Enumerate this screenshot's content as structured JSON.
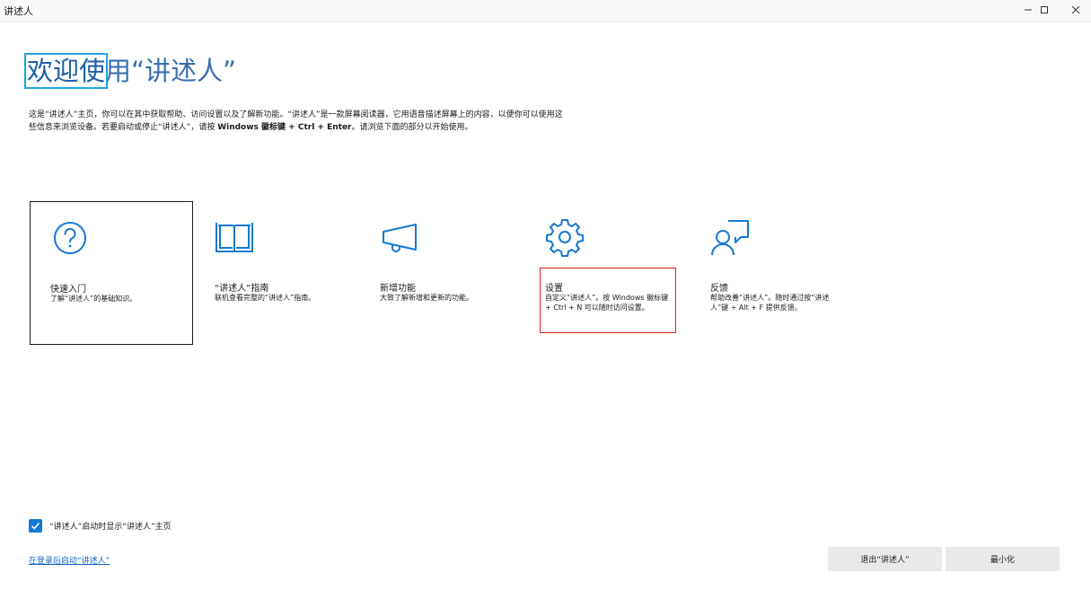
{
  "window": {
    "title": "讲述人",
    "minimize_glyph": "−",
    "maximize_glyph": "□",
    "close_glyph": "×"
  },
  "heading": {
    "focused_part": "欢迎使",
    "rest": "用“讲述人”"
  },
  "intro": {
    "part1": "这是“讲述人”主页，你可以在其中获取帮助、访问设置以及了解新功能。“讲述人”是一款屏幕阅读器，它用语音描述屏幕上的内容，以便你可以使用这些信息来浏览设备。若要启动或停止“讲述人”，请按 ",
    "shortcut": "Windows 徽标键 + Ctrl + Enter",
    "part2": "。请浏览下面的部分以开始使用。"
  },
  "cards": [
    {
      "id": "quickstart",
      "icon": "question-circle-icon",
      "title": "快速入门",
      "desc": "了解“讲述人”的基础知识。"
    },
    {
      "id": "guide",
      "icon": "book-icon",
      "title": "“讲述人”指南",
      "desc": "联机查看完整的“讲述人”指南。"
    },
    {
      "id": "whatsnew",
      "icon": "megaphone-icon",
      "title": "新增功能",
      "desc": "大致了解新增和更新的功能。"
    },
    {
      "id": "settings",
      "icon": "gear-icon",
      "title": "设置",
      "desc": "自定义“讲述人”。按 Windows 徽标键 + Ctrl + N 可以随时访问设置。"
    },
    {
      "id": "feedback",
      "icon": "feedback-person-icon",
      "title": "反馈",
      "desc": "帮助改善“讲述人”。随时通过按“讲述人”键 + Alt + F 提供反馈。"
    }
  ],
  "show_home_checkbox": {
    "checked": true,
    "label": "“讲述人”启动时显示“讲述人”主页"
  },
  "signin_link": "在登录后启动“讲述人”",
  "buttons": {
    "exit": "退出“讲述人”",
    "minimize": "最小化"
  },
  "colors": {
    "accent": "#1478d4",
    "heading": "#1f5fa8",
    "focus_ring": "#1fa3e0",
    "highlight": "#e02020"
  }
}
